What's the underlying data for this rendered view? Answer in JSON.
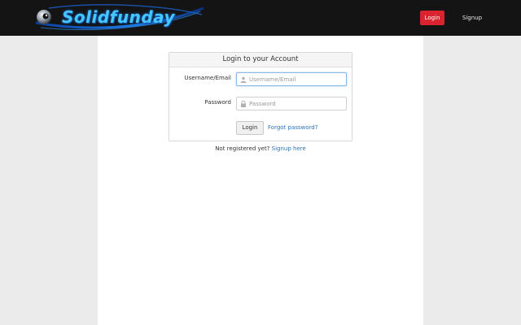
{
  "header": {
    "logo_text": "Solidfunday",
    "login_label": "Login",
    "signup_label": "Signup"
  },
  "login_panel": {
    "title": "Login to your Account",
    "username_label": "Username/Email",
    "username_placeholder": "Username/Email",
    "username_value": "",
    "password_label": "Password",
    "password_placeholder": "Password",
    "password_value": "",
    "submit_label": "Login",
    "forgot_link": "Forgot password?"
  },
  "register": {
    "prompt": "Not registered yet?",
    "link": "Signup here"
  },
  "colors": {
    "navbar_bg": "#141414",
    "accent_red": "#d9232e",
    "link_blue": "#2a73b8",
    "logo_blue": "#46c6ff"
  },
  "icons": {
    "username_icon": "user-icon",
    "password_icon": "lock-icon",
    "logo_icon": "globe-eye-icon"
  }
}
